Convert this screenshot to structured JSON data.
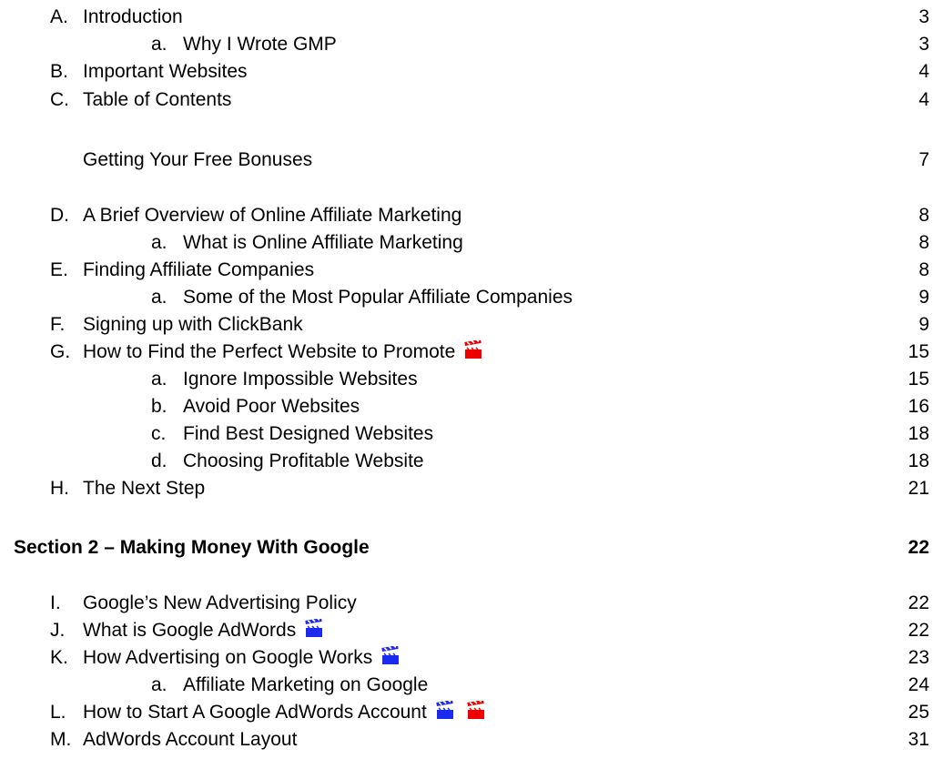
{
  "toc": [
    {
      "letter": "A.",
      "title": "Introduction",
      "page": "3"
    },
    {
      "letter": "a.",
      "title": "Why I Wrote GMP",
      "page": "3"
    },
    {
      "letter": "B.",
      "title": "Important Websites",
      "page": "4"
    },
    {
      "letter": "C.",
      "title": "Table of Contents",
      "page": "4"
    },
    {
      "title": "Getting Your Free Bonuses",
      "page": "7"
    },
    {
      "letter": "D.",
      "title": "A Brief Overview of Online Affiliate Marketing",
      "page": "8"
    },
    {
      "letter": "a.",
      "title": "What is Online Affiliate Marketing",
      "page": "8"
    },
    {
      "letter": "E.",
      "title": "Finding Affiliate Companies",
      "page": "8"
    },
    {
      "letter": "a.",
      "title": "Some of the Most Popular Affiliate Companies",
      "page": "9"
    },
    {
      "letter": "F.",
      "title": "Signing up with ClickBank",
      "page": "9"
    },
    {
      "letter": "G.",
      "title": "How to Find the Perfect Website to Promote",
      "page": "15",
      "icons": [
        "red-clapperboard-icon"
      ]
    },
    {
      "letter": "a.",
      "title": "Ignore Impossible Websites",
      "page": "15"
    },
    {
      "letter": "b.",
      "title": "Avoid Poor Websites",
      "page": "16"
    },
    {
      "letter": "c.",
      "title": "Find Best Designed Websites",
      "page": "18"
    },
    {
      "letter": "d.",
      "title": "Choosing Profitable Website",
      "page": "18"
    },
    {
      "letter": "H.",
      "title": "The Next Step",
      "page": "21"
    },
    {
      "title": "Section 2 – Making Money With Google",
      "page": "22"
    },
    {
      "letter": "I.",
      "title": "Google’s New Advertising Policy",
      "page": "22"
    },
    {
      "letter": "J.",
      "title": "What is Google AdWords",
      "page": "22",
      "icons": [
        "blue-clapperboard-icon"
      ]
    },
    {
      "letter": "K.",
      "title": "How Advertising on Google Works",
      "page": "23",
      "icons": [
        "blue-clapperboard-icon"
      ]
    },
    {
      "letter": "a.",
      "title": "Affiliate Marketing on Google",
      "page": "24"
    },
    {
      "letter": "L.",
      "title": "How to Start A Google AdWords Account",
      "page": "25",
      "icons": [
        "blue-clapperboard-icon",
        "red-clapperboard-icon"
      ]
    },
    {
      "letter": "M.",
      "title": "AdWords Account Layout",
      "page": "31"
    }
  ],
  "colors": {
    "red_clapper": "#ee0000",
    "blue_clapper": "#1a2aee"
  }
}
